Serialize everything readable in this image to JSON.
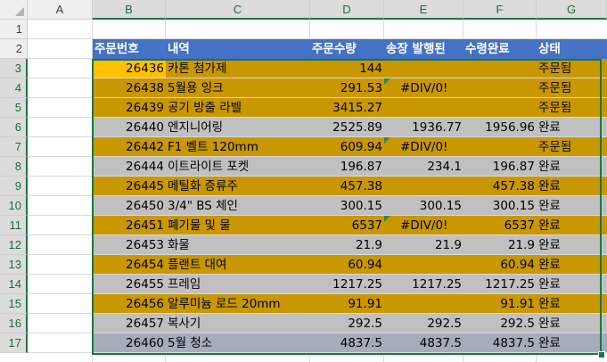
{
  "columns": [
    "A",
    "B",
    "C",
    "D",
    "E",
    "F",
    "G"
  ],
  "rows": [
    "1",
    "2",
    "3",
    "4",
    "5",
    "6",
    "7",
    "8",
    "9",
    "10",
    "11",
    "12",
    "13",
    "14",
    "15",
    "16",
    "17"
  ],
  "colors": {
    "header_fill": "#4472c4",
    "gold": "#c99700",
    "gray": "#c0c0c0",
    "blue_gray": "#a5acba",
    "active_cell": "#ffc000",
    "selection": "#217346"
  },
  "table": {
    "headers": [
      "주문번호",
      "내역",
      "주문수량",
      "송장 발행된",
      "수령완료",
      "상태"
    ],
    "rows": [
      {
        "id": "26436",
        "desc": "카톤 첨가제",
        "qty": "144",
        "invoiced": "",
        "received": "",
        "status": "주문됨",
        "style": "gold"
      },
      {
        "id": "26438",
        "desc": "5월용 잉크",
        "qty": "291.53",
        "invoiced": "#DIV/0!",
        "received": "",
        "status": "주문됨",
        "style": "gold",
        "err": true
      },
      {
        "id": "26439",
        "desc": "공기 방출 라벨",
        "qty": "3415.27",
        "invoiced": "",
        "received": "",
        "status": "주문됨",
        "style": "gold"
      },
      {
        "id": "26440",
        "desc": "엔지니어링",
        "qty": "2525.89",
        "invoiced": "1936.77",
        "received": "1956.96",
        "status": "완료",
        "style": "gray"
      },
      {
        "id": "26442",
        "desc": "F1 벨트 120mm",
        "qty": "609.94",
        "invoiced": "#DIV/0!",
        "received": "",
        "status": "주문됨",
        "style": "gold",
        "err": true
      },
      {
        "id": "26444",
        "desc": "이트라이트 포켓",
        "qty": "196.87",
        "invoiced": "234.1",
        "received": "196.87",
        "status": "완료",
        "style": "gray"
      },
      {
        "id": "26445",
        "desc": "메틸화 증류주",
        "qty": "457.38",
        "invoiced": "",
        "received": "457.38",
        "status": "완료",
        "style": "gold"
      },
      {
        "id": "26450",
        "desc": "3/4\" BS 체인",
        "qty": "300.15",
        "invoiced": "300.15",
        "received": "300.15",
        "status": "완료",
        "style": "gray"
      },
      {
        "id": "26451",
        "desc": "폐기물 및 물",
        "qty": "6537",
        "invoiced": "#DIV/0!",
        "received": "6537",
        "status": "완료",
        "style": "gold",
        "err": true
      },
      {
        "id": "26453",
        "desc": "화물",
        "qty": "21.9",
        "invoiced": "21.9",
        "received": "21.9",
        "status": "완료",
        "style": "gray"
      },
      {
        "id": "26454",
        "desc": "플랜트 대여",
        "qty": "60.94",
        "invoiced": "",
        "received": "60.94",
        "status": "완료",
        "style": "gold"
      },
      {
        "id": "26455",
        "desc": "프레임",
        "qty": "1217.25",
        "invoiced": "1217.25",
        "received": "1217.25",
        "status": "완료",
        "style": "gray"
      },
      {
        "id": "26456",
        "desc": "알루미늄 로드 20mm",
        "qty": "91.91",
        "invoiced": "",
        "received": "91.91",
        "status": "완료",
        "style": "gold"
      },
      {
        "id": "26457",
        "desc": "복사기",
        "qty": "292.5",
        "invoiced": "292.5",
        "received": "292.5",
        "status": "완료",
        "style": "gray"
      },
      {
        "id": "26460",
        "desc": "5월 청소",
        "qty": "4837.5",
        "invoiced": "4837.5",
        "received": "4837.5",
        "status": "완료",
        "style": "bluegray"
      }
    ]
  }
}
